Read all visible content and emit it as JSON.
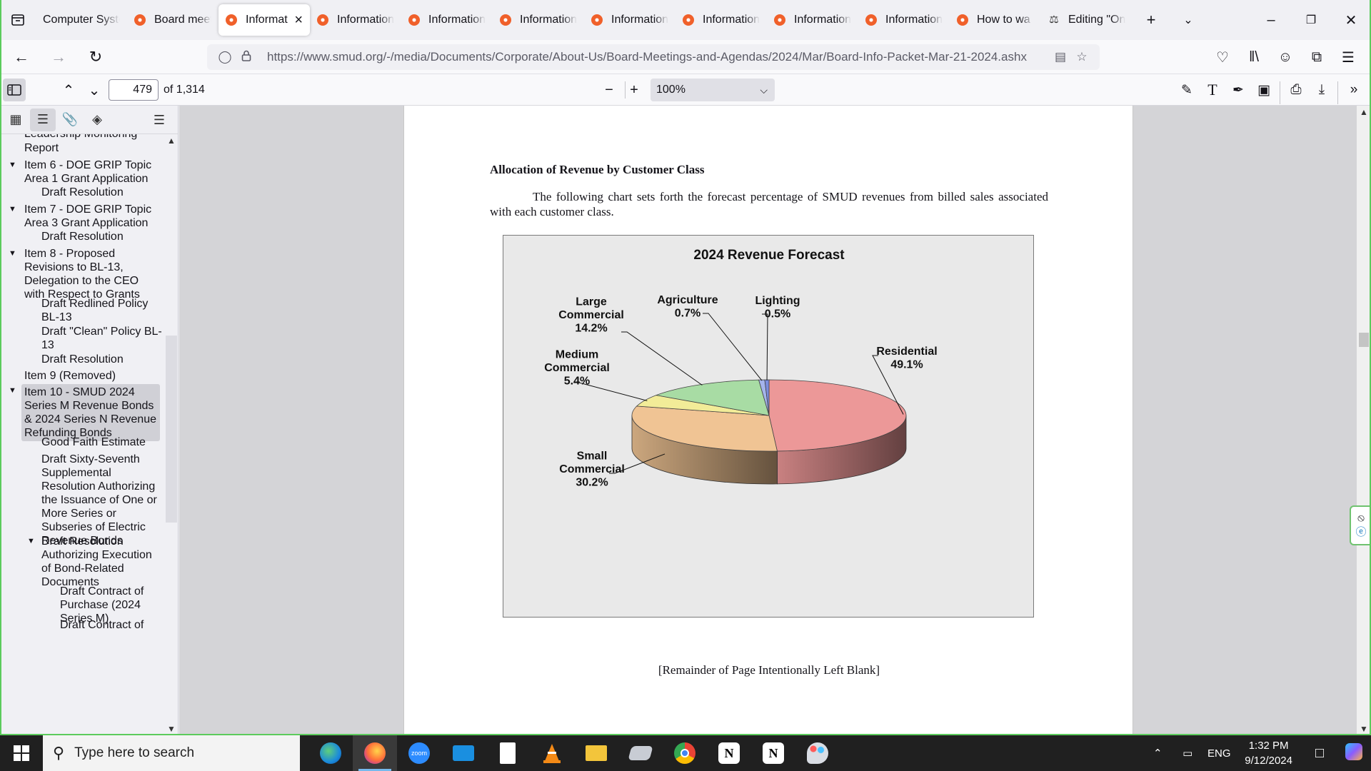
{
  "browser": {
    "tabs": [
      {
        "label": "Computer Syste",
        "icon": "tab-list"
      },
      {
        "label": "Board meet",
        "icon": "firefox-dot"
      },
      {
        "label": "Informat",
        "icon": "firefox-dot",
        "active": true
      },
      {
        "label": "Information",
        "icon": "firefox-dot"
      },
      {
        "label": "Information",
        "icon": "firefox-dot"
      },
      {
        "label": "Information",
        "icon": "firefox-dot"
      },
      {
        "label": "Information",
        "icon": "firefox-dot"
      },
      {
        "label": "Information",
        "icon": "firefox-dot"
      },
      {
        "label": "Information",
        "icon": "firefox-dot"
      },
      {
        "label": "Information",
        "icon": "firefox-dot"
      },
      {
        "label": "How to wa",
        "icon": "firefox-dot"
      },
      {
        "label": "Editing \"On",
        "icon": "scales"
      }
    ],
    "new_tab_symbol": "+",
    "url": "https://www.smud.org/-/media/Documents/Corporate/About-Us/Board-Meetings-and-Agendas/2024/Mar/Board-Info-Packet-Mar-21-2024.ashx"
  },
  "pdf_toolbar": {
    "page_number": "479",
    "page_count": "of 1,314",
    "zoom": "100%"
  },
  "outline": [
    {
      "label": "Leadership Monitoring",
      "level": 0,
      "expanded": null
    },
    {
      "label": "Report",
      "level": 0,
      "expanded": null
    },
    {
      "label": "Item 6 - DOE GRIP Topic Area 1 Grant Application",
      "level": 0,
      "expanded": true
    },
    {
      "label": "Draft Resolution",
      "level": 1,
      "expanded": null
    },
    {
      "label": "Item 7 - DOE GRIP Topic Area 3 Grant Application",
      "level": 0,
      "expanded": true
    },
    {
      "label": "Draft Resolution",
      "level": 1,
      "expanded": null
    },
    {
      "label": "Item 8 - Proposed Revisions to BL-13, Delegation to the CEO with Respect to Grants",
      "level": 0,
      "expanded": true
    },
    {
      "label": "Draft Redlined Policy BL-13",
      "level": 1,
      "expanded": null
    },
    {
      "label": "Draft \"Clean\" Policy BL-13",
      "level": 1,
      "expanded": null
    },
    {
      "label": "Draft Resolution",
      "level": 1,
      "expanded": null
    },
    {
      "label": "Item 9 (Removed)",
      "level": 0,
      "expanded": null
    },
    {
      "label": "Item 10 - SMUD 2024 Series M Revenue Bonds & 2024 Series N Revenue Refunding Bonds",
      "level": 0,
      "expanded": true,
      "selected": true
    },
    {
      "label": "Good Faith Estimate",
      "level": 1,
      "expanded": null
    },
    {
      "label": "Draft Sixty-Seventh Supplemental Resolution Authorizing the Issuance of One or More Series or Subseries of Electric Revenue Bonds",
      "level": 1,
      "expanded": null
    },
    {
      "label": "Draft Resolution Authorizing Execution of Bond-Related Documents",
      "level": 1,
      "expanded": true
    },
    {
      "label": "Draft Contract of Purchase (2024 Series M)",
      "level": 2,
      "expanded": null
    },
    {
      "label": "Draft Contract of",
      "level": 2,
      "expanded": null
    }
  ],
  "document": {
    "heading": "Allocation of Revenue by Customer Class",
    "paragraph": "The following chart sets forth the forecast percentage of SMUD revenues from billed sales associated with each customer class.",
    "footer": "[Remainder of Page Intentionally Left Blank]"
  },
  "chart_data": {
    "type": "pie",
    "title": "2024 Revenue Forecast",
    "three_d": true,
    "slices": [
      {
        "label": "Residential",
        "value": 49.1,
        "value_label": "49.1%",
        "color": "#ec9898"
      },
      {
        "label": "Small Commercial",
        "value": 30.2,
        "value_label": "30.2%",
        "color": "#f0c494"
      },
      {
        "label": "Medium Commercial",
        "value": 5.4,
        "value_label": "5.4%",
        "color": "#f2ec98"
      },
      {
        "label": "Large Commercial",
        "value": 14.2,
        "value_label": "14.2%",
        "color": "#a8dca4"
      },
      {
        "label": "Agriculture",
        "value": 0.7,
        "value_label": "0.7%",
        "color": "#a4b4ec"
      },
      {
        "label": "Lighting",
        "value": 0.5,
        "value_label": "0.5%",
        "color": "#7a8cdc"
      }
    ]
  },
  "taskbar": {
    "search_placeholder": "Type here to search",
    "zoom_app_label": "zoom",
    "language": "ENG",
    "time": "1:32 PM",
    "date": "9/12/2024"
  }
}
